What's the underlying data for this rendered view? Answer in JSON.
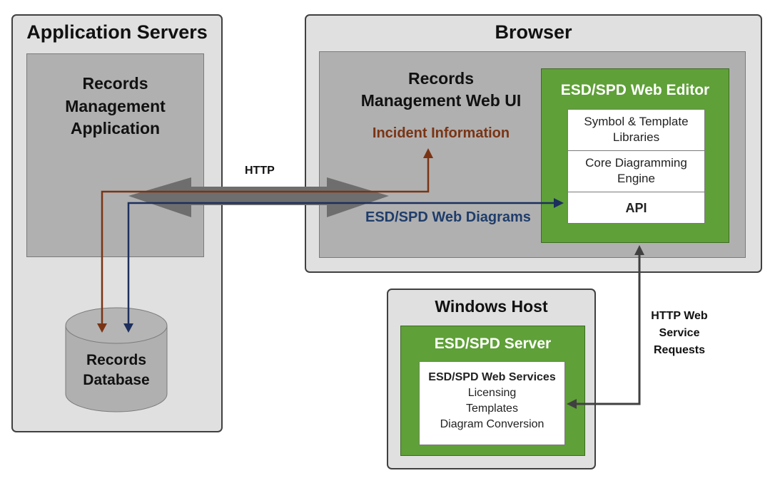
{
  "app_servers": {
    "title": "Application Servers",
    "app_box": {
      "lines": [
        "Records",
        "Management",
        "Application"
      ]
    },
    "database": {
      "lines": [
        "Records",
        "Database"
      ]
    }
  },
  "browser": {
    "title": "Browser",
    "web_ui": {
      "lines": [
        "Records",
        "Management Web UI"
      ],
      "incident_label": "Incident Information"
    },
    "web_editor": {
      "title": "ESD/SPD Web Editor",
      "components": [
        {
          "lines": [
            "Symbol & Template",
            "Libraries"
          ]
        },
        {
          "lines": [
            "Core Diagramming",
            "Engine"
          ]
        },
        {
          "lines": [
            "API"
          ]
        }
      ]
    }
  },
  "windows_host": {
    "title": "Windows Host",
    "server": {
      "title": "ESD/SPD Server",
      "services": {
        "heading": "ESD/SPD Web Services",
        "items": [
          "Licensing",
          "Templates",
          "Diagram Conversion"
        ]
      }
    }
  },
  "connections": {
    "http_label": "HTTP",
    "web_diagrams_label": "ESD/SPD Web Diagrams",
    "web_service_label": [
      "HTTP Web",
      "Service",
      "Requests"
    ]
  },
  "colors": {
    "incident_flow": "#7a3414",
    "diagram_flow": "#1c2f5e",
    "service_flow": "#404040",
    "http_arrow": "#6e6e6e",
    "green": "#5fa038"
  }
}
